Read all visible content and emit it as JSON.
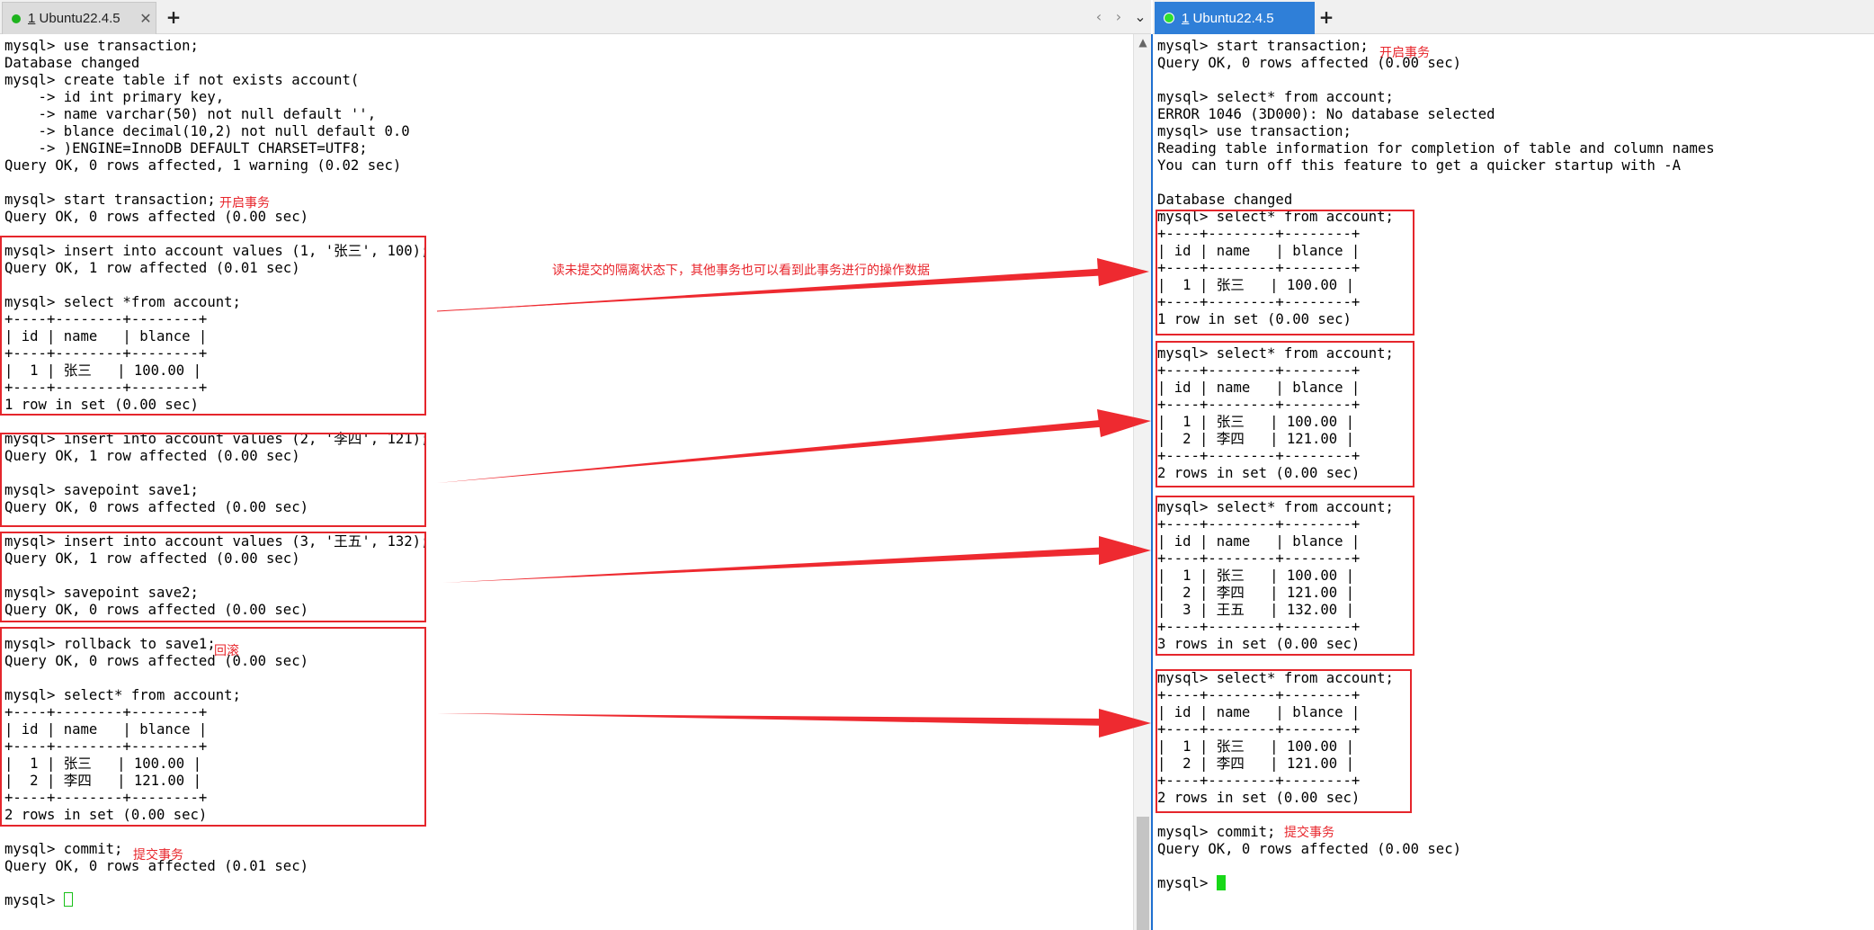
{
  "left_tab": {
    "number": "1",
    "title": "Ubuntu22.4.5",
    "close": "✕",
    "add": "+"
  },
  "right_tab": {
    "number": "1",
    "title": "Ubuntu22.4.5",
    "add": "+"
  },
  "nav": {
    "prev": "‹",
    "next": "›",
    "menu": "⌄"
  },
  "left_terminal": [
    "mysql> use transaction;",
    "Database changed",
    "mysql> create table if not exists account(",
    "    -> id int primary key,",
    "    -> name varchar(50) not null default '',",
    "    -> blance decimal(10,2) not null default 0.0",
    "    -> )ENGINE=InnoDB DEFAULT CHARSET=UTF8;",
    "Query OK, 0 rows affected, 1 warning (0.02 sec)",
    "",
    "mysql> start transaction;",
    "Query OK, 0 rows affected (0.00 sec)",
    "",
    "mysql> insert into account values (1, '张三', 100);",
    "Query OK, 1 row affected (0.01 sec)",
    "",
    "mysql> select *from account;",
    "+----+--------+--------+",
    "| id | name   | blance |",
    "+----+--------+--------+",
    "|  1 | 张三   | 100.00 |",
    "+----+--------+--------+",
    "1 row in set (0.00 sec)",
    "",
    "mysql> insert into account values (2, '李四', 121);",
    "Query OK, 1 row affected (0.00 sec)",
    "",
    "mysql> savepoint save1;",
    "Query OK, 0 rows affected (0.00 sec)",
    "",
    "mysql> insert into account values (3, '王五', 132);",
    "Query OK, 1 row affected (0.00 sec)",
    "",
    "mysql> savepoint save2;",
    "Query OK, 0 rows affected (0.00 sec)",
    "",
    "mysql> rollback to save1;",
    "Query OK, 0 rows affected (0.00 sec)",
    "",
    "mysql> select* from account;",
    "+----+--------+--------+",
    "| id | name   | blance |",
    "+----+--------+--------+",
    "|  1 | 张三   | 100.00 |",
    "|  2 | 李四   | 121.00 |",
    "+----+--------+--------+",
    "2 rows in set (0.00 sec)",
    "",
    "mysql> commit;",
    "Query OK, 0 rows affected (0.01 sec)",
    ""
  ],
  "left_prompt": "mysql> ",
  "right_terminal": [
    "mysql> start transaction;",
    "Query OK, 0 rows affected (0.00 sec)",
    "",
    "mysql> select* from account;",
    "ERROR 1046 (3D000): No database selected",
    "mysql> use transaction;",
    "Reading table information for completion of table and column names",
    "You can turn off this feature to get a quicker startup with -A",
    "",
    "Database changed",
    "mysql> select* from account;",
    "+----+--------+--------+",
    "| id | name   | blance |",
    "+----+--------+--------+",
    "|  1 | 张三   | 100.00 |",
    "+----+--------+--------+",
    "1 row in set (0.00 sec)",
    "",
    "mysql> select* from account;",
    "+----+--------+--------+",
    "| id | name   | blance |",
    "+----+--------+--------+",
    "|  1 | 张三   | 100.00 |",
    "|  2 | 李四   | 121.00 |",
    "+----+--------+--------+",
    "2 rows in set (0.00 sec)",
    "",
    "mysql> select* from account;",
    "+----+--------+--------+",
    "| id | name   | blance |",
    "+----+--------+--------+",
    "|  1 | 张三   | 100.00 |",
    "|  2 | 李四   | 121.00 |",
    "|  3 | 王五   | 132.00 |",
    "+----+--------+--------+",
    "3 rows in set (0.00 sec)",
    "",
    "mysql> select* from account;",
    "+----+--------+--------+",
    "| id | name   | blance |",
    "+----+--------+--------+",
    "|  1 | 张三   | 100.00 |",
    "|  2 | 李四   | 121.00 |",
    "+----+--------+--------+",
    "2 rows in set (0.00 sec)",
    "",
    "mysql> commit;",
    "Query OK, 0 rows affected (0.00 sec)",
    ""
  ],
  "right_prompt": "mysql> ",
  "annotations": {
    "left_start": "开启事务",
    "left_rollback": "回滚",
    "left_commit": "提交事务",
    "middle_note": "读未提交的隔离状态下，其他事务也可以看到此事务进行的操作数据",
    "right_start": "开启事务",
    "right_commit": "提交事务"
  },
  "colors": {
    "annotation_red": "#e5262c",
    "active_tab_blue": "#2f7fd8",
    "status_green": "#1db31d"
  }
}
